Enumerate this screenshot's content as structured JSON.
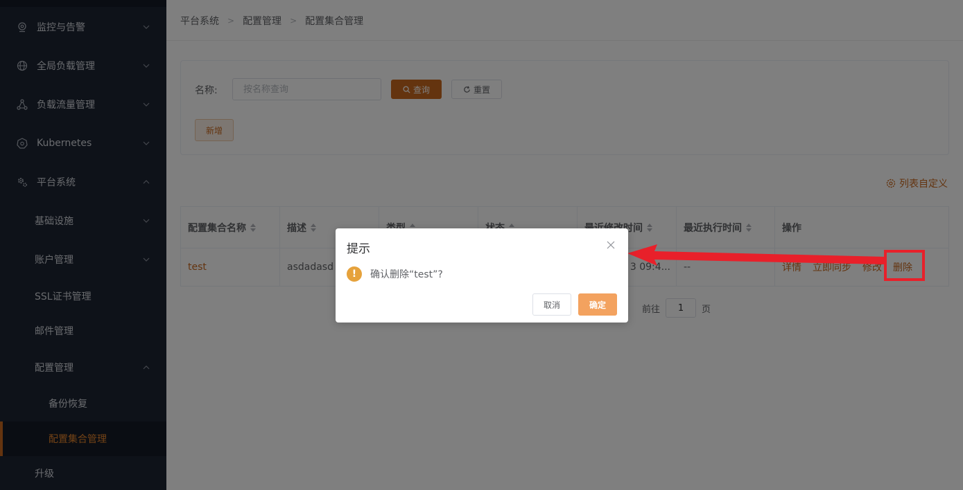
{
  "sidebar": {
    "items": [
      {
        "label": "监控与告警",
        "icon": "monitor-icon",
        "chevron": "down"
      },
      {
        "label": "全局负载管理",
        "icon": "globe-icon",
        "chevron": "down"
      },
      {
        "label": "负载流量管理",
        "icon": "network-icon",
        "chevron": "down"
      },
      {
        "label": "Kubernetes",
        "icon": "kubernetes-icon",
        "chevron": "down"
      },
      {
        "label": "平台系统",
        "icon": "gear-icon",
        "chevron": "up"
      },
      {
        "label": "基础设施",
        "chevron": "down"
      },
      {
        "label": "账户管理",
        "chevron": "down"
      },
      {
        "label": "SSL证书管理"
      },
      {
        "label": "邮件管理"
      },
      {
        "label": "配置管理",
        "chevron": "up"
      },
      {
        "label": "备份恢复"
      },
      {
        "label": "配置集合管理",
        "active": true
      },
      {
        "label": "升级"
      }
    ]
  },
  "breadcrumb": [
    "平台系统",
    "配置管理",
    "配置集合管理"
  ],
  "search": {
    "label": "名称:",
    "placeholder": "按名称查询",
    "query_label": "查询",
    "reset_label": "重置",
    "add_label": "新增"
  },
  "customize_label": "列表自定义",
  "table": {
    "columns": [
      "配置集合名称",
      "描述",
      "类型",
      "状态",
      "最近修改时间",
      "最近执行时间",
      "操作"
    ],
    "rows": [
      {
        "name": "test",
        "desc": "asdadasd",
        "type": "",
        "status": "",
        "modified": "3 09:4...",
        "executed": "--",
        "actions": [
          "详情",
          "立即同步",
          "修改",
          "删除"
        ]
      }
    ]
  },
  "pagination": {
    "goto_label": "前往",
    "page": "1",
    "page_unit": "页"
  },
  "dialog": {
    "title": "提示",
    "message": "确认删除“test”?",
    "cancel_label": "取消",
    "ok_label": "确定"
  },
  "colors": {
    "accent": "#c8691f",
    "sidebar_bg": "#1d2433",
    "highlight": "#e8202a",
    "warning": "#e6a23c"
  }
}
